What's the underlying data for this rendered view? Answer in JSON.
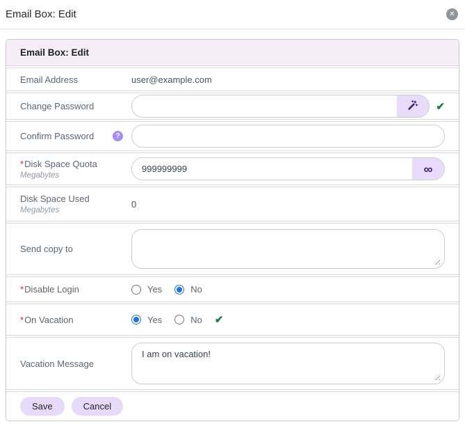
{
  "window": {
    "title": "Email Box: Edit",
    "close_glyph": "✕"
  },
  "panel": {
    "title": "Email Box: Edit"
  },
  "fields": {
    "email_address": {
      "label": "Email Address",
      "value": "user@example.com"
    },
    "change_password": {
      "label": "Change Password",
      "value": "",
      "generate_icon": "magic-wand",
      "valid_mark": "✔"
    },
    "confirm_password": {
      "label": "Confirm Password",
      "help_mark": "?",
      "value": ""
    },
    "disk_space_quota": {
      "required_mark": "*",
      "label": "Disk Space Quota",
      "unit": "Megabytes",
      "value": "999999999",
      "unlimited_glyph": "∞"
    },
    "disk_space_used": {
      "label": "Disk Space Used",
      "unit": "Megabytes",
      "value": "0"
    },
    "send_copy_to": {
      "label": "Send copy to",
      "value": ""
    },
    "disable_login": {
      "required_mark": "*",
      "label": "Disable Login",
      "options": [
        "Yes",
        "No"
      ],
      "selected": "No"
    },
    "on_vacation": {
      "required_mark": "*",
      "label": "On Vacation",
      "options": [
        "Yes",
        "No"
      ],
      "selected": "Yes",
      "valid_mark": "✔"
    },
    "vacation_message": {
      "label": "Vacation Message",
      "value": "I am on vacation!"
    }
  },
  "actions": {
    "save": "Save",
    "cancel": "Cancel"
  },
  "colors": {
    "header_bg": "#f5eef7",
    "accent_light": "#e9dcfa",
    "accent_dark": "#3d2176",
    "help_icon_bg": "#a78bfa",
    "success": "#1b7e3c",
    "radio_selected": "#1a73e8",
    "required": "#cb2431"
  }
}
